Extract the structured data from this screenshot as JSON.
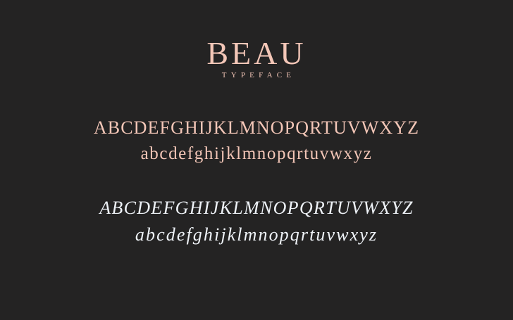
{
  "colors": {
    "background": "#242323",
    "accent": "#f3c6b7",
    "italic_text": "#eef2f7"
  },
  "specimen": {
    "title": "BEAU",
    "subtitle": "TYPEFACE",
    "regular": {
      "uppercase": "ABCDEFGHIJKLMNOPQRTUVWXYZ",
      "lowercase": "abcdefghijklmnopqrtuvwxyz"
    },
    "italic": {
      "uppercase": "ABCDEFGHIJKLMNOPQRTUVWXYZ",
      "lowercase": "abcdefghijklmnopqrtuvwxyz"
    }
  }
}
